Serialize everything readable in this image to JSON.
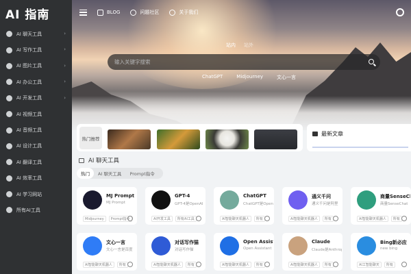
{
  "logo": "AI 指南",
  "sidebar": {
    "items": [
      {
        "label": "AI 聊天工具",
        "icon": "chat-icon"
      },
      {
        "label": "AI 写作工具",
        "icon": "pen-icon"
      },
      {
        "label": "AI 图片工具",
        "icon": "image-icon"
      },
      {
        "label": "AI 办公工具",
        "icon": "office-icon"
      },
      {
        "label": "AI 开发工具",
        "icon": "code-icon"
      },
      {
        "label": "AI 视频工具",
        "icon": "video-icon"
      },
      {
        "label": "AI 音频工具",
        "icon": "audio-icon"
      },
      {
        "label": "AI 设计工具",
        "icon": "design-icon"
      },
      {
        "label": "AI 翻译工具",
        "icon": "translate-icon"
      },
      {
        "label": "AI 效率工具",
        "icon": "efficiency-icon"
      },
      {
        "label": "AI 学习网站",
        "icon": "learning-icon"
      },
      {
        "label": "所有AI工具",
        "icon": "all-tools-icon"
      }
    ]
  },
  "topbar": {
    "links": [
      {
        "label": "BLOG",
        "icon": "book-icon"
      },
      {
        "label": "问题社区",
        "icon": "community-icon"
      },
      {
        "label": "关于我们",
        "icon": "about-icon"
      }
    ]
  },
  "search": {
    "tabs": [
      "站内",
      "站外"
    ],
    "placeholder": "输入关键字搜索",
    "quick_links": [
      "ChatGPT",
      "Midjourney",
      "文心一言"
    ]
  },
  "banner": {
    "hot_label": "热门推荐"
  },
  "news": {
    "title": "最新文章"
  },
  "section": {
    "title": "AI 聊天工具",
    "filters": [
      "热门",
      "AI 聊天工具",
      "Prompt指令"
    ]
  },
  "cards": [
    {
      "name": "MJ Prompt",
      "desc": "MJ Prompt",
      "tags": [
        "Midjourney",
        "Prompt指令"
      ],
      "color": "#1a1a2e"
    },
    {
      "name": "GPT-4",
      "desc": "GPT-4是OpenAI",
      "tags": [
        "AI开发工具",
        "所有AI工具"
      ],
      "color": "#111111"
    },
    {
      "name": "ChatGPT",
      "desc": "ChatGPT是OpenAI",
      "tags": [
        "AI智能聊天机器人",
        "所有"
      ],
      "color": "#74aa9c"
    },
    {
      "name": "通义千问",
      "desc": "通义千问是阿里",
      "tags": [
        "AI智能聊天机器人",
        "所有"
      ],
      "color": "#6f5ff0"
    },
    {
      "name": "商量SenseChat",
      "desc": "商量SenseChat",
      "tags": [
        "AI智能聊天机器人",
        "所有"
      ],
      "color": "#2f9e7e"
    },
    {
      "name": "文心一言",
      "desc": "文心一言是百度",
      "tags": [
        "AI智能聊天机器人",
        "所有"
      ],
      "color": "#2f7cf6"
    },
    {
      "name": "对话写作猫",
      "desc": "对话写作猫",
      "tags": [
        "AI智能聊天机器人",
        "所有"
      ],
      "color": "#2f5bd6"
    },
    {
      "name": "Open Assistant",
      "desc": "Open Assistant",
      "tags": [
        "AI智能聊天机器人",
        "所有"
      ],
      "color": "#1f6fe5"
    },
    {
      "name": "Claude",
      "desc": "Claude是Anthropic",
      "tags": [
        "AI智能聊天机器人",
        "所有"
      ],
      "color": "#c9a27e"
    },
    {
      "name": "Bing新必应",
      "desc": "new bing",
      "tags": [
        "AI工智能聊天",
        "所有"
      ],
      "color": "#2a8de0"
    }
  ]
}
